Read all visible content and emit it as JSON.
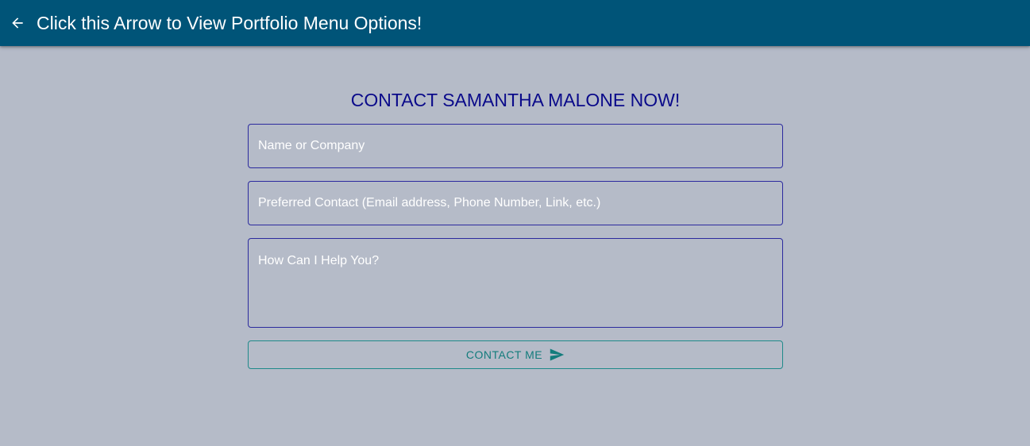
{
  "appbar": {
    "title": "Click this Arrow to View Portfolio Menu Options!",
    "back_icon": "arrow-left-icon",
    "background": "#005478"
  },
  "form": {
    "heading": "CONTACT SAMANTHA MALONE NOW!",
    "name_placeholder": "Name or Company",
    "contact_placeholder": "Preferred Contact (Email address, Phone Number, Link, etc.)",
    "message_placeholder": "How Can I Help You?",
    "submit_label": "CONTACT ME",
    "submit_icon": "send-icon",
    "heading_color": "#0a0a8a",
    "accent_color": "#137c7c"
  },
  "page": {
    "background": "#b5bbc8"
  }
}
